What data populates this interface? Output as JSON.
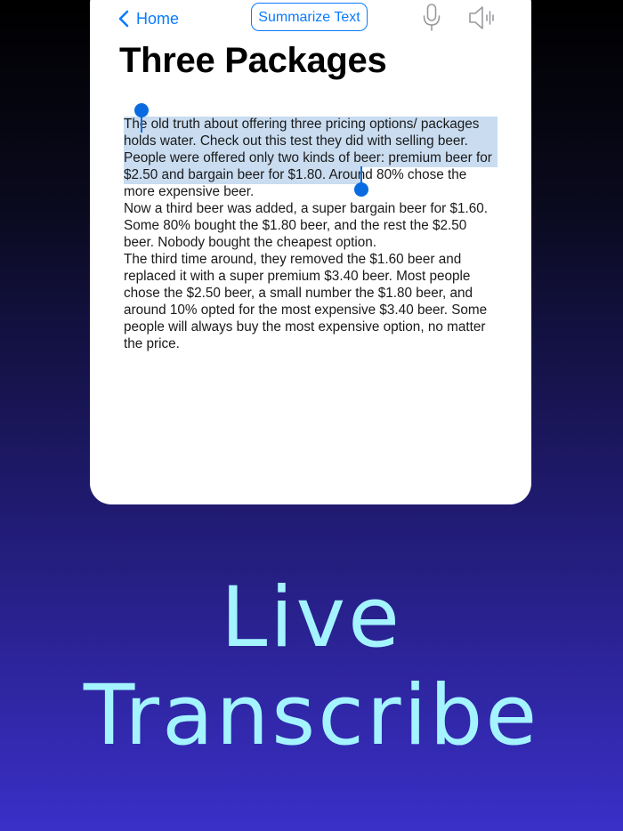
{
  "nav": {
    "home_label": "Home",
    "summarize_label": "Summarize Text",
    "icons": [
      "chevron-left-icon",
      "microphone-icon",
      "speaker-waveform-icon"
    ],
    "accent_color": "#0a7bff"
  },
  "document": {
    "title": "Three Packages",
    "paragraphs": [
      "The old truth about offering three pricing options/ packages holds water. Check out this test they did with selling beer.",
      "People were offered only two kinds of beer: premium beer for $2.50 and bargain beer for $1.80. Around 80% chose the more expensive beer.",
      "Now a third beer was added, a super bargain beer for $1.60. Some 80% bought the $1.80 beer, and the rest the $2.50 beer. Nobody bought the cheapest option.",
      "The third time around, they removed the $1.60 beer and replaced it with a super premium $3.40 beer. Most people chose the $2.50 beer, a small number the $1.80 beer, and around 10% opted for the most expensive $3.40 beer. Some people will always buy the most expensive option, no matter the price."
    ],
    "selection_color": "#c9dcf0"
  },
  "promo": {
    "line1": "Live",
    "line2": "Transcribe",
    "text_color": "#a4f4ff"
  }
}
